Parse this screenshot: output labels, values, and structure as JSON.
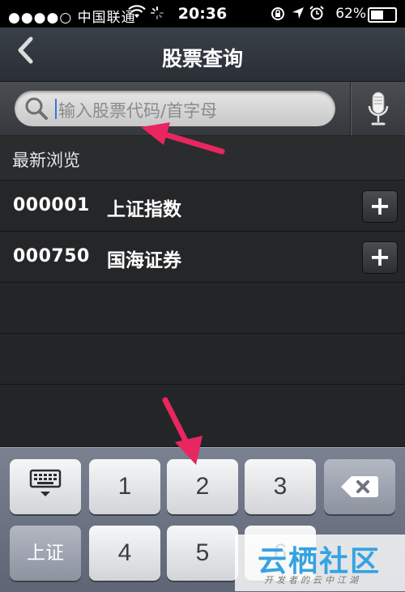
{
  "status_bar": {
    "carrier": "●●●●○ 中国联通",
    "time": "20:36",
    "battery": "62%",
    "battery_level": 0.62
  },
  "nav": {
    "back_icon": "chevron-left",
    "title": "股票查询"
  },
  "search": {
    "placeholder": "输入股票代码/首字母",
    "icon": "search-icon",
    "mic_icon": "microphone-icon"
  },
  "recent": {
    "header": "最新浏览",
    "items": [
      {
        "code": "000001",
        "name": "上证指数",
        "add_label": "+"
      },
      {
        "code": "000750",
        "name": "国海证券",
        "add_label": "+"
      }
    ]
  },
  "keyboard": {
    "keys_row1": [
      "1",
      "2",
      "3"
    ],
    "keys_row2": [
      "上证",
      "4",
      "5",
      "6"
    ],
    "backspace_icon": "backspace-icon",
    "hide_keyboard_icon": "keyboard-hide-icon"
  },
  "watermark": {
    "brand": "云栖社区",
    "tagline": "开发者的云中江湖"
  },
  "colors": {
    "arrow": "#e8265f",
    "cursor": "#3a74d8"
  }
}
